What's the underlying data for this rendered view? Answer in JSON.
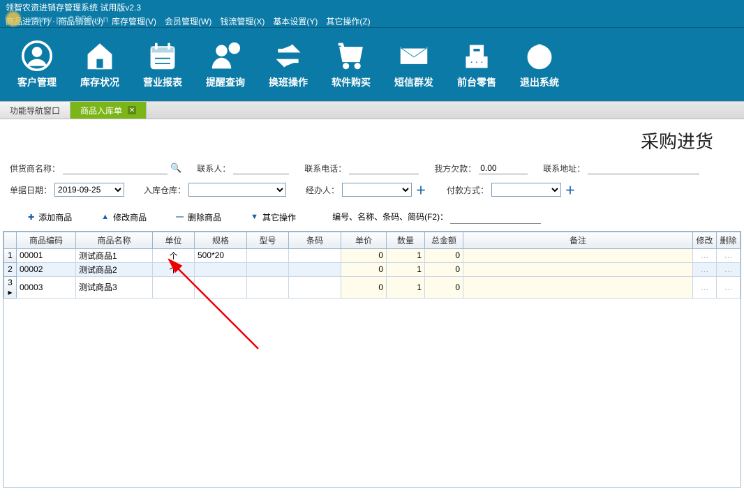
{
  "app": {
    "title": "领智农资进销存管理系统 试用版v2.3",
    "watermark_url": "www.pc0359.cn"
  },
  "menu": {
    "items": [
      "商品进货(T)",
      "商品销售(U)",
      "库存管理(V)",
      "会员管理(W)",
      "钱流管理(X)",
      "基本设置(Y)",
      "其它操作(Z)"
    ]
  },
  "toolbar": {
    "buttons": [
      {
        "icon": "user-circle",
        "label": "客户管理"
      },
      {
        "icon": "house",
        "label": "库存状况"
      },
      {
        "icon": "calendar",
        "label": "营业报表"
      },
      {
        "icon": "alert-person",
        "label": "提醒查询"
      },
      {
        "icon": "swap",
        "label": "换班操作"
      },
      {
        "icon": "cart",
        "label": "软件购买"
      },
      {
        "icon": "envelope",
        "label": "短信群发"
      },
      {
        "icon": "register",
        "label": "前台零售"
      },
      {
        "icon": "power",
        "label": "退出系统"
      }
    ]
  },
  "tabs": {
    "inactive": "功能导航窗口",
    "active": "商品入库单"
  },
  "page_title": "采购进货",
  "form": {
    "supplier_label": "供货商名称：",
    "contact_label": "联系人：",
    "phone_label": "联系电话：",
    "debt_label": "我方欠款：",
    "debt_value": "0.00",
    "address_label": "联系地址：",
    "date_label": "单据日期：",
    "date_value": "2019-09-25",
    "warehouse_label": "入库仓库：",
    "handler_label": "经办人：",
    "payment_label": "付款方式："
  },
  "actions": {
    "add": "添加商品",
    "modify": "修改商品",
    "delete": "删除商品",
    "other": "其它操作",
    "search_label": "编号、名称、条码、简码(F2)："
  },
  "grid": {
    "headers": [
      "",
      "商品编码",
      "商品名称",
      "单位",
      "规格",
      "型号",
      "条码",
      "单价",
      "数量",
      "总金额",
      "备注",
      "修改",
      "删除"
    ],
    "rows": [
      {
        "n": "1",
        "code": "00001",
        "name": "测试商品1",
        "unit": "个",
        "spec": "500*20",
        "model": "",
        "barcode": "",
        "price": "0",
        "qty": "1",
        "total": "0",
        "remark": ""
      },
      {
        "n": "2",
        "code": "00002",
        "name": "测试商品2",
        "unit": "个",
        "spec": "",
        "model": "",
        "barcode": "",
        "price": "0",
        "qty": "1",
        "total": "0",
        "remark": ""
      },
      {
        "n": "3 ▸",
        "code": "00003",
        "name": "测试商品3",
        "unit": "",
        "spec": "",
        "model": "",
        "barcode": "",
        "price": "0",
        "qty": "1",
        "total": "0",
        "remark": ""
      }
    ]
  }
}
